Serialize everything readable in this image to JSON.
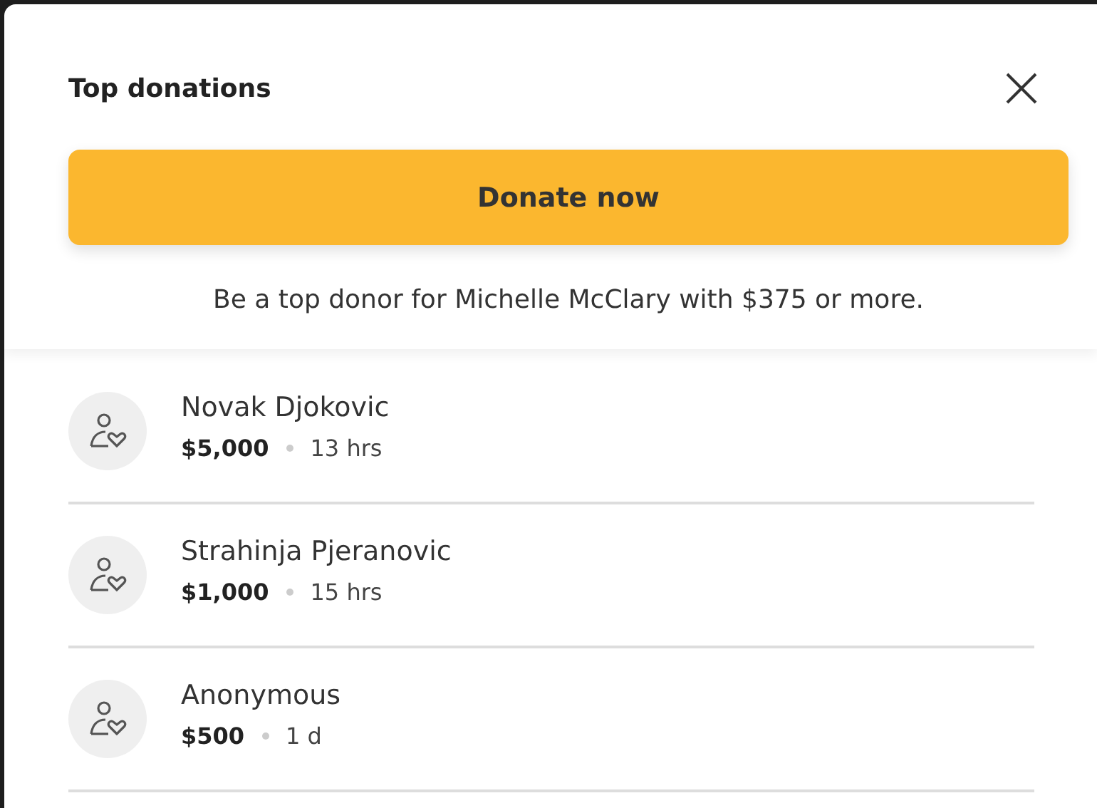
{
  "title": "Top donations",
  "donate_button": "Donate now",
  "subtitle": "Be a top donor for Michelle McClary with $375 or more.",
  "donations": [
    {
      "name": "Novak Djokovic",
      "amount": "$5,000",
      "time": "13 hrs"
    },
    {
      "name": "Strahinja Pjeranovic",
      "amount": "$1,000",
      "time": "15 hrs"
    },
    {
      "name": "Anonymous",
      "amount": "$500",
      "time": "1 d"
    }
  ]
}
